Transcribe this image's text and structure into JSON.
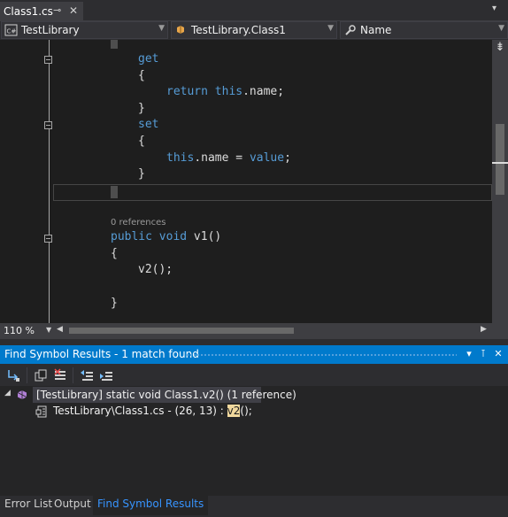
{
  "tab": {
    "title": "Class1.cs",
    "pin_icon": "pin-icon",
    "close_glyph": "✕"
  },
  "navbar": {
    "project": "TestLibrary",
    "project_badge": "C#",
    "type": "TestLibrary.Class1",
    "member": "Name"
  },
  "code": {
    "codelens": "0 references",
    "lines": {
      "get": "get",
      "open1": "{",
      "return_kw": "return",
      "this1": "this",
      "return_rest": ".name;",
      "close1": "}",
      "set": "set",
      "open2": "{",
      "this2": "this",
      "assign_mid": ".name = ",
      "value_kw": "value",
      "semicolon": ";",
      "close2": "}",
      "decl_kw": "public void",
      "decl_rest": " v1()",
      "open3": "{",
      "call": "v2();",
      "close3": "}"
    }
  },
  "zoom": "110 %",
  "tool_window": {
    "title": "Find Symbol Results - 1 match found",
    "result_symbol": "[TestLibrary] static void Class1.v2() (1 reference)",
    "result_location": "TestLibrary\\Class1.cs - (26, 13) : ",
    "match_text": "v2",
    "match_rest": "();"
  },
  "bottom_tabs": [
    "Error List",
    "Output",
    "Find Symbol Results"
  ],
  "colors": {
    "accent": "#007acc",
    "keyword": "#569cd6",
    "editor_bg": "#1e1e1e"
  }
}
